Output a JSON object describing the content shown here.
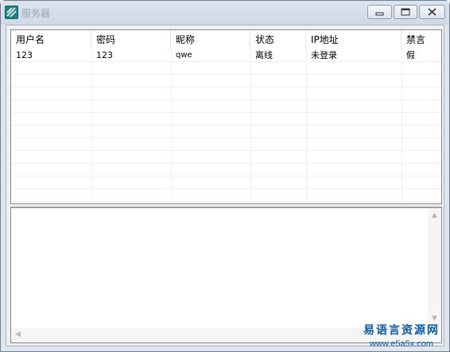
{
  "window": {
    "title": "服务器"
  },
  "table": {
    "columns": [
      "用户名",
      "密码",
      "昵称",
      "状态",
      "IP地址",
      "禁言"
    ],
    "rows": [
      [
        "123",
        "123",
        "qwe",
        "离线",
        "未登录",
        "假"
      ]
    ]
  },
  "log": {
    "text": ""
  },
  "watermark": {
    "cn": "易语言资源网",
    "url": "www.e5a5x.com"
  },
  "colors": {
    "title_text": "#9aa6b3",
    "watermark": "#0a5aa8"
  },
  "icons": [
    "app-icon",
    "minimize-icon",
    "maximize-icon",
    "close-icon",
    "scroll-up-arrow-icon",
    "scroll-down-arrow-icon",
    "scroll-left-arrow-icon"
  ]
}
